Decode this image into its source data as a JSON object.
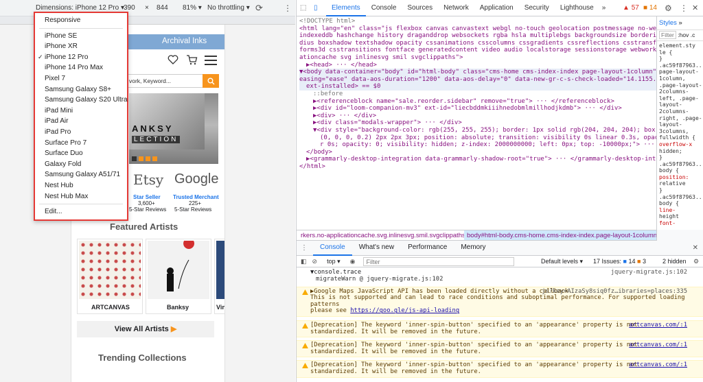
{
  "device_toolbar": {
    "dimensions_label": "Dimensions: iPhone 12 Pro",
    "width": "390",
    "x_sep": "×",
    "height": "844",
    "zoom": "81%",
    "throttle": "No throttling"
  },
  "device_menu": {
    "items": [
      "Responsive",
      "iPhone SE",
      "iPhone XR",
      "iPhone 12 Pro",
      "iPhone 14 Pro Max",
      "Pixel 7",
      "Samsung Galaxy S8+",
      "Samsung Galaxy S20 Ultra",
      "iPad Mini",
      "iPad Air",
      "iPad Pro",
      "Surface Pro 7",
      "Surface Duo",
      "Galaxy Fold",
      "Samsung Galaxy A51/71",
      "Nest Hub",
      "Nest Hub Max",
      "Edit..."
    ],
    "selected": "iPhone 12 Pro"
  },
  "site": {
    "nav_partial": "ng",
    "nav_archival": "Archival Inks",
    "search_placeholder": "vork, Keyword...",
    "banner_text1": "ANKSY",
    "banner_text2": "LECTION",
    "etsy": "Etsy",
    "google": "Google",
    "star_seller": "Star Seller",
    "etsy_reviews": "3,600+",
    "etsy_reviews_label": "5-Star Reviews",
    "trusted": "Trusted Merchant",
    "google_reviews": "225+",
    "google_reviews_label": "5-Star Reviews",
    "featured_title": "Featured Artists",
    "artist1": "ARTCANVAS",
    "artist2": "Banksy",
    "artist3": "Vin",
    "view_all": "View All Artists",
    "trending": "Trending Collections"
  },
  "devtools": {
    "tabs": [
      "Elements",
      "Console",
      "Sources",
      "Network",
      "Application",
      "Security",
      "Lighthouse"
    ],
    "active_tab": "Elements",
    "more": "»",
    "error_count": "57",
    "warn_count": "14",
    "styles_tab": "Styles",
    "styles_more": "»",
    "filter": "Filter",
    "hov": ":hov",
    "dot": ".c",
    "elements_lines": [
      "<!DOCTYPE html>",
      "<html lang=\"en\" class=\"js flexbox canvas canvastext webgl no-touch geolocation postmessage no-websqldatabase",
      "indexeddb hashchange history draganddrop websockets rgba hsla multiplebgs backgroundsize borderimage borderra",
      "dius boxshadow textshadow opacity cssanimations csscolumns cssgradients cssreflections csstransforms csstrans",
      "forms3d csstransitions fontface generatedcontent video audio localstorage sessionstorage webworkers no-applic",
      "ationcache svg inlinesvg smil svgclippaths\">",
      "▶<head> ··· </head>",
      "▼<body data-container=\"body\" id=\"html-body\" class=\"cms-home cms-index-index page-layout-1column\" data-aos-",
      "easing=\"ease\" data-aos-duration=\"1200\" data-aos-delay=\"0\" data-new-gr-c-s-check-loaded=\"14.1155.0\" data-gr-",
      "ext-installed> == $0",
      "::before",
      "▶<referenceblock name=\"sale.reorder.sidebar\" remove=\"true\"> ··· </referenceblock>",
      "▶<div id=\"loom-companion-mv3\" ext-id=\"liecbddmkiiihnedobmlmillhodjkdmb\"> ··· </div>",
      "▶<div> ··· </div>",
      "▶<div class=\"modals-wrapper\"> ··· </div>",
      "▼<div style=\"background-color: rgb(255, 255, 255); border: 1px solid rgb(204, 204, 204); box-shadow: rgba",
      "(0, 0, 0, 0.2) 2px 2px 3px; position: absolute; transition: visibility 0s linear 0.3s, opacity 0.3s linea",
      "r 0s; opacity: 0; visibility: hidden; z-index: 2000000000; left: 0px; top: -10000px;\"> ··· </div>",
      "</body>",
      "▶<grammarly-desktop-integration data-grammarly-shadow-root=\"true\"> ··· </grammarly-desktop-integration>",
      "</html>"
    ],
    "styles_lines": [
      "element.sty",
      "le {",
      "}",
      ".ac59f87963...",
      "page-layout-",
      "1column,",
      ".page-layout-",
      "2columns-",
      "left, .page-",
      "layout-",
      "2columns-",
      "right, .page-",
      "layout-",
      "3columns,",
      "fullwidth {",
      "overflow-x",
      "hidden;",
      "}",
      ".ac59f87963...",
      "body {",
      "position:",
      "relative",
      "}",
      ".ac59f87963...",
      "body {",
      "line-",
      "height",
      "font-"
    ],
    "breadcrumb_left": "rkers.no-applicationcache.svg.inlinesvg.smil.svgclippaths",
    "breadcrumb_right": "body#html-body.cms-home.cms-index-index.page-layout-1column",
    "console_tabs": [
      "Console",
      "What's new",
      "Performance",
      "Memory"
    ],
    "console_top": "top",
    "console_filter": "Filter",
    "default_levels": "Default levels",
    "issues_label": "17 Issues:",
    "issues_blue": "14",
    "issues_yellow": "3",
    "hidden": "2 hidden",
    "trace1": "▼console.trace",
    "trace1_src": "jquery-migrate.js:102",
    "trace2": "migrateWarn @ jquery-migrate.js:102",
    "warn1_l1": "▶Google Maps JavaScript API has been loaded directly without a callback.",
    "warn1_src": "js?key=AIzaSy8siq0fz…ibraries=places:335",
    "warn1_l2": "This is not supported and can lead to race conditions and suboptimal performance. For supported loading patterns",
    "warn1_l3a": "please see ",
    "warn1_link": "https://goo.gle/js-api-loading",
    "dep_l1": "[Deprecation] The keyword 'inner-spin-button' specified to an 'appearance' property is not",
    "dep_l2": "standardized. It will be removed in the future.",
    "dep_src": "artcanvas.com/:1",
    "prompt": "›"
  },
  "colors": {
    "accent": "#1a73e8",
    "orange": "#f7941d",
    "highlight_red": "#e53935",
    "nav_blue": "#7fa8d4"
  }
}
